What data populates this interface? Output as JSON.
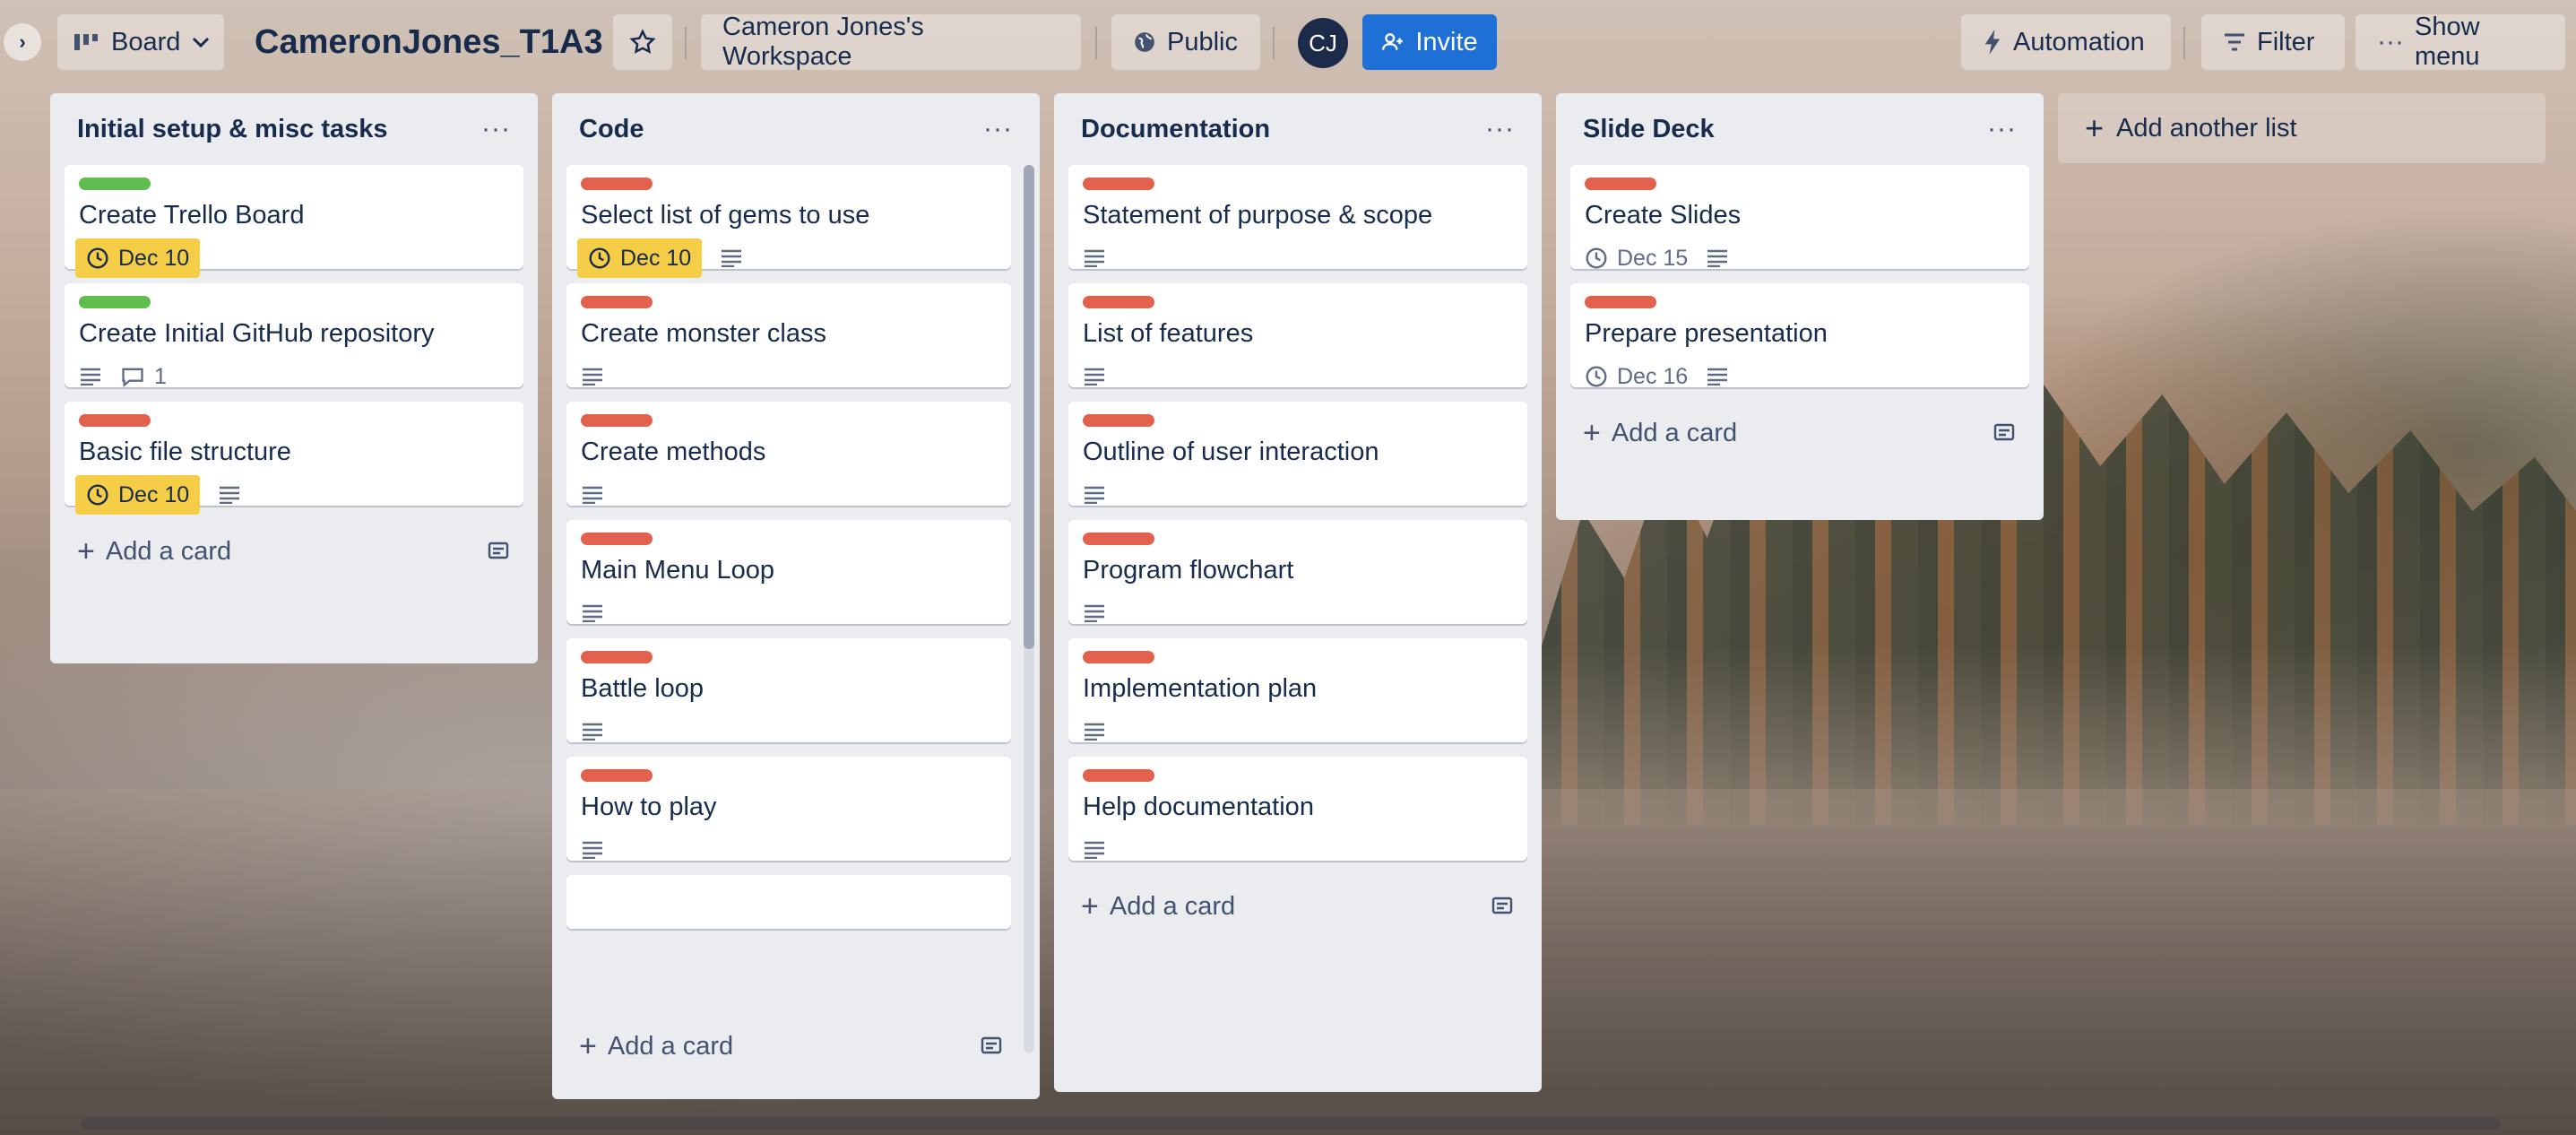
{
  "header": {
    "view_label": "Board",
    "board_title": "CameronJones_T1A3",
    "workspace_label": "Cameron Jones's Workspace",
    "visibility_label": "Public",
    "avatar_initials": "CJ",
    "invite_label": "Invite",
    "automation_label": "Automation",
    "filter_label": "Filter",
    "show_menu_label": "Show menu"
  },
  "colors": {
    "label_green": "#61bd4f",
    "label_red": "#e2614f",
    "due_yellow": "#f5cd47",
    "invite_blue": "#1f70d6"
  },
  "lists": [
    {
      "title": "Initial setup & misc tasks",
      "cards": [
        {
          "label": "green",
          "title": "Create Trello Board",
          "due": "Dec 10"
        },
        {
          "label": "green",
          "title": "Create Initial GitHub repository",
          "comments": "1"
        },
        {
          "label": "red",
          "title": "Basic file structure",
          "due": "Dec 10"
        }
      ]
    },
    {
      "title": "Code",
      "cards": [
        {
          "label": "red",
          "title": "Select list of gems to use",
          "due": "Dec 10"
        },
        {
          "label": "red",
          "title": "Create monster class"
        },
        {
          "label": "red",
          "title": "Create methods"
        },
        {
          "label": "red",
          "title": "Main Menu Loop"
        },
        {
          "label": "red",
          "title": "Battle loop"
        },
        {
          "label": "red",
          "title": "How to play"
        }
      ]
    },
    {
      "title": "Documentation",
      "cards": [
        {
          "label": "red",
          "title": "Statement of purpose & scope"
        },
        {
          "label": "red",
          "title": "List of features"
        },
        {
          "label": "red",
          "title": "Outline of user interaction"
        },
        {
          "label": "red",
          "title": "Program flowchart"
        },
        {
          "label": "red",
          "title": "Implementation plan"
        },
        {
          "label": "red",
          "title": "Help documentation"
        }
      ]
    },
    {
      "title": "Slide Deck",
      "cards": [
        {
          "label": "red",
          "title": "Create Slides",
          "due": "Dec 15"
        },
        {
          "label": "red",
          "title": "Prepare presentation",
          "due": "Dec 16"
        }
      ]
    }
  ],
  "add_card_label": "Add a card",
  "add_list_label": "Add another list",
  "icons": {
    "collapse": "chevron-right-icon",
    "board": "board-icon",
    "star": "star-icon",
    "globe": "globe-icon",
    "add_person": "add-person-icon",
    "automation": "bolt-icon",
    "filter": "filter-icon",
    "more": "more-horizontal-icon",
    "clock": "clock-icon",
    "description": "description-icon",
    "comment": "comment-icon",
    "template": "card-template-icon",
    "plus": "plus-icon"
  }
}
